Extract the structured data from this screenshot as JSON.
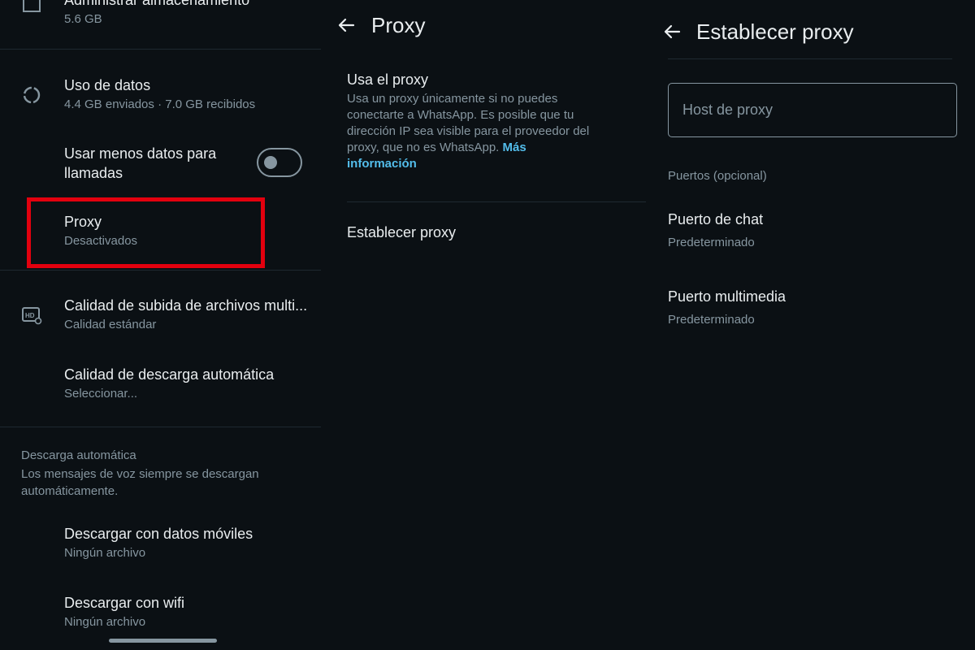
{
  "left_panel": {
    "storage": {
      "title": "Administrar almacenamiento",
      "subtitle": "5.6 GB",
      "icon": "folder-icon"
    },
    "data_usage": {
      "title": "Uso de datos",
      "subtitle": "4.4 GB enviados · 7.0 GB recibidos",
      "icon": "data-usage-icon"
    },
    "less_data_calls": {
      "title_line1": "Usar menos datos para",
      "title_line2": "llamadas",
      "toggle_on": false
    },
    "proxy": {
      "title": "Proxy",
      "subtitle": "Desactivados"
    },
    "media_upload": {
      "title": "Calidad de subida de archivos multi...",
      "subtitle": "Calidad estándar",
      "icon": "hd-icon"
    },
    "auto_download_quality": {
      "title": "Calidad de descarga automática",
      "subtitle": "Seleccionar..."
    },
    "auto_download_section": {
      "label": "Descarga automática",
      "desc_line1": "Los mensajes de voz siempre se descargan",
      "desc_line2": "automáticamente."
    },
    "mobile_data": {
      "title": "Descargar con datos móviles",
      "subtitle": "Ningún archivo"
    },
    "wifi": {
      "title": "Descargar con wifi",
      "subtitle": "Ningún archivo"
    }
  },
  "mid_panel": {
    "header_title": "Proxy",
    "use_proxy": {
      "title": "Usa el proxy",
      "desc": "Usa un proxy únicamente si no puedes conectarte a WhatsApp. Es posible que tu dirección IP sea visible para el proveedor del proxy, que no es WhatsApp. ",
      "link": "Más información"
    },
    "set_proxy": "Establecer proxy"
  },
  "right_panel": {
    "header_title": "Establecer proxy",
    "host_placeholder": "Host de proxy",
    "ports_label": "Puertos (opcional)",
    "chat_port": {
      "title": "Puerto de chat",
      "subtitle": "Predeterminado"
    },
    "media_port": {
      "title": "Puerto multimedia",
      "subtitle": "Predeterminado"
    }
  },
  "colors": {
    "background": "#0b1014",
    "primary_text": "#e9edef",
    "secondary_text": "#8696a0",
    "link": "#53bdeb",
    "highlight": "#e3000e"
  }
}
